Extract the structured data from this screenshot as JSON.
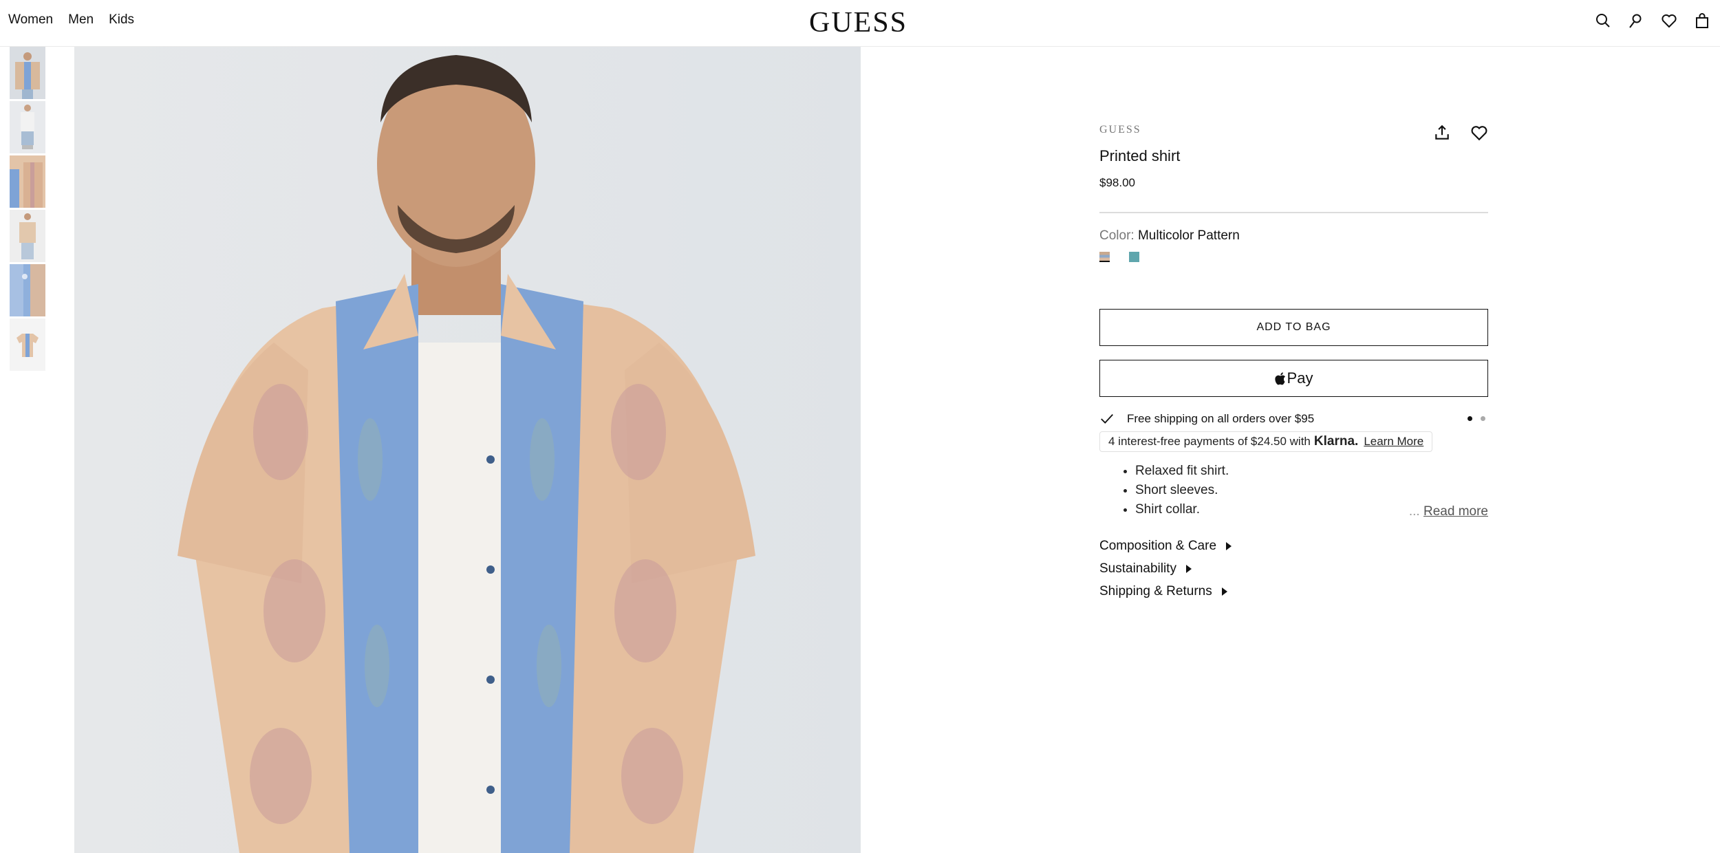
{
  "header": {
    "nav": [
      "Women",
      "Men",
      "Kids"
    ],
    "logo": "GUESS",
    "icons": [
      "search-icon",
      "account-icon",
      "wishlist-icon",
      "bag-icon"
    ]
  },
  "gallery": {
    "thumbnail_count": 6,
    "selected_index": 0
  },
  "product": {
    "brand": "GUESS",
    "title": "Printed shirt",
    "price": "$98.00",
    "color_label": "Color:",
    "color_value": "Multicolor Pattern",
    "swatches": [
      {
        "name": "Multicolor Pattern",
        "color": "#c9a98e",
        "selected": true
      },
      {
        "name": "Teal",
        "color": "#5fa6ad",
        "selected": false
      }
    ],
    "add_to_bag": "ADD TO BAG",
    "apple_pay": "Pay",
    "shipping_promo": "Free shipping on all orders over $95",
    "promo_dots": 2,
    "klarna": {
      "prefix": "4 interest-free payments of $24.50 with",
      "brand": "Klarna.",
      "link": "Learn More"
    },
    "features": [
      "Relaxed fit shirt.",
      "Short sleeves.",
      "Shirt collar."
    ],
    "read_more_ellipsis": "...",
    "read_more": "Read more",
    "accordions": [
      "Composition & Care",
      "Sustainability",
      "Shipping & Returns"
    ]
  },
  "colors": {
    "text": "#111111",
    "muted": "#777777",
    "shirt_blue": "#7ea3d6",
    "shirt_peach": "#e9c7a8"
  }
}
